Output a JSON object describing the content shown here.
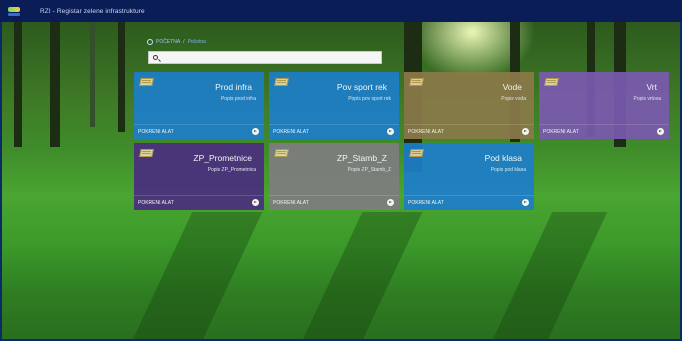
{
  "app": {
    "title": "RZI - Registar zelene infrastrukture"
  },
  "breadcrumb": {
    "home": "POČETNA",
    "separator": "/",
    "current": "Početna"
  },
  "search": {
    "placeholder": ""
  },
  "tiles": [
    {
      "title": "Prod infra",
      "subtitle": "Popis prod infra",
      "launch": "POKRENI ALAT",
      "color": "#1e7ec8",
      "icon": "book-icon"
    },
    {
      "title": "Pov sport rek",
      "subtitle": "Popis pov sport rek",
      "launch": "POKRENI ALAT",
      "color": "#1e7ec8",
      "icon": "book-icon"
    },
    {
      "title": "Vode",
      "subtitle": "Popis voda",
      "launch": "POKRENI ALAT",
      "color": "#8a7a48",
      "icon": "book-icon"
    },
    {
      "title": "Vrt",
      "subtitle": "Popis vrtova",
      "launch": "POKRENI ALAT",
      "color": "#7a5aae",
      "icon": "book-icon"
    },
    {
      "title": "ZP_Prometnice",
      "subtitle": "Popis ZP_Prometnica",
      "launch": "POKRENI ALAT",
      "color": "#4a2f7e",
      "icon": "book-icon"
    },
    {
      "title": "ZP_Stamb_Z",
      "subtitle": "Popis ZP_Stamb_Z",
      "launch": "POKRENI ALAT",
      "color": "#7e7e7e",
      "icon": "book-icon"
    },
    {
      "title": "Pod klasa",
      "subtitle": "Popis pod klasa",
      "launch": "POKRENI ALAT",
      "color": "#1e7ec8",
      "icon": "book-icon"
    }
  ]
}
